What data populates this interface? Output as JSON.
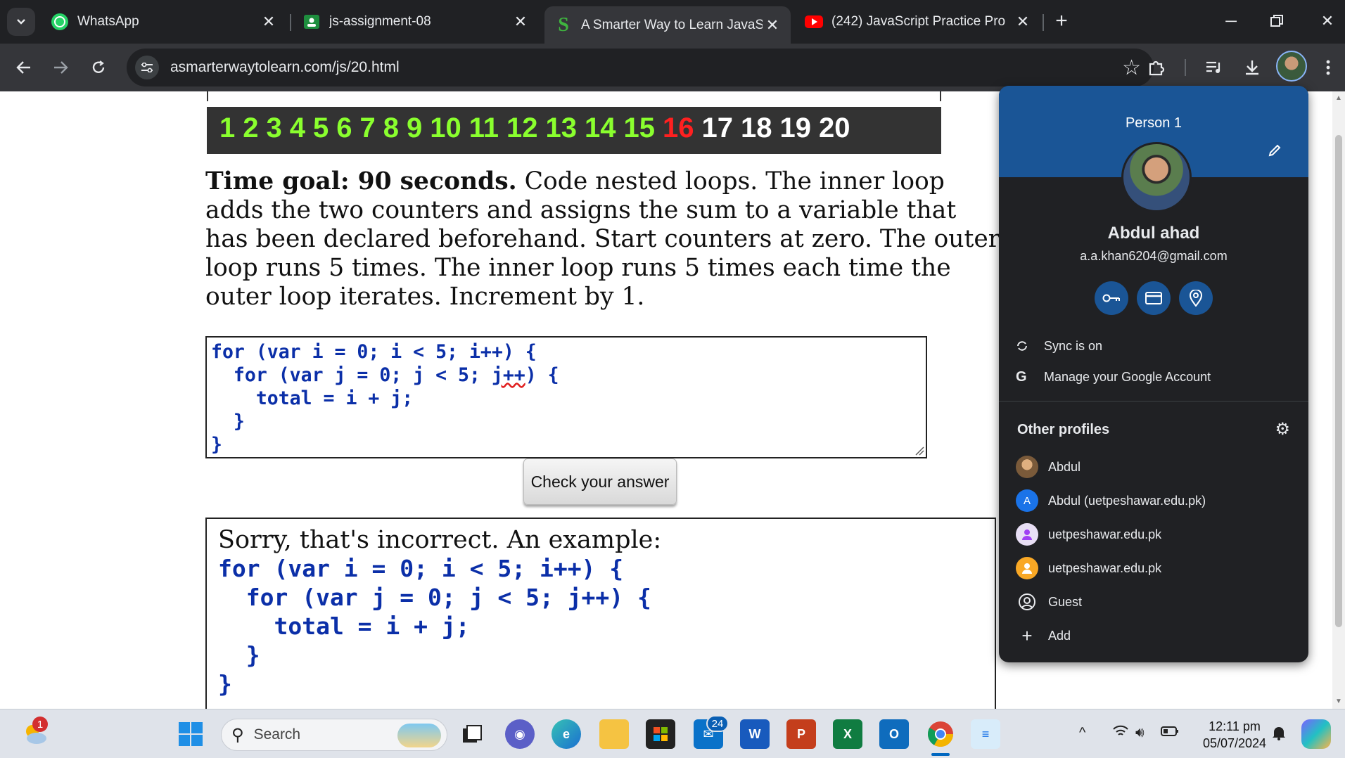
{
  "tabs": [
    {
      "title": "WhatsApp",
      "active": false
    },
    {
      "title": "js-assignment-08",
      "active": false
    },
    {
      "title": "A Smarter Way to Learn JavaScr",
      "active": true
    },
    {
      "title": "(242)  JavaScript Practice Pro",
      "active": false
    }
  ],
  "address_bar": {
    "url": "asmarterwaytolearn.com/js/20.html"
  },
  "page": {
    "numbers": [
      "1",
      "2",
      "3",
      "4",
      "5",
      "6",
      "7",
      "8",
      "9",
      "10",
      "11",
      "12",
      "13",
      "14",
      "15",
      "16",
      "17",
      "18",
      "19",
      "20"
    ],
    "instructions_bold": "Time goal: 90 seconds.",
    "instructions_text": " Code nested loops. The inner loop adds the two counters and assigns the sum to a variable that has been declared beforehand. Start counters at zero. The outer loop runs 5 times. The inner loop runs 5 times each time the outer loop iterates. Increment by 1.",
    "code_lines": {
      "l1": "for (var i = 0; i < 5; i++) {",
      "l2a": "  for (var j = 0; j < 5; ",
      "l2b": "j++",
      "l2c": ") {",
      "l3": "    total = i + j;",
      "l4": "  }",
      "l5": "}"
    },
    "check_button": "Check your answer",
    "result_title": "Sorry, that's incorrect. An example:",
    "result_code": "for (var i = 0; i < 5; i++) {\n  for (var j = 0; j < 5; j++) {\n    total = i + j;\n  }\n}"
  },
  "profile_menu": {
    "person_label": "Person 1",
    "name": "Abdul ahad",
    "email": "a.a.khan6204@gmail.com",
    "sync": "Sync is on",
    "manage": "Manage your Google Account",
    "other_profiles_heading": "Other profiles",
    "profiles": [
      "Abdul",
      "Abdul (uetpeshawar.edu.pk)",
      "uetpeshawar.edu.pk",
      "uetpeshawar.edu.pk",
      "Guest",
      "Add"
    ],
    "profile_initial": "A"
  },
  "taskbar": {
    "search_label": "Search",
    "weather_badge": "1",
    "whatsapp_badge": "24",
    "time": "12:11 pm",
    "date": "05/07/2024"
  },
  "colors": {
    "accent": "#1a5596",
    "number_green": "#8aff2e",
    "number_current": "#ff2020",
    "code_blue": "#0b2fa8"
  }
}
